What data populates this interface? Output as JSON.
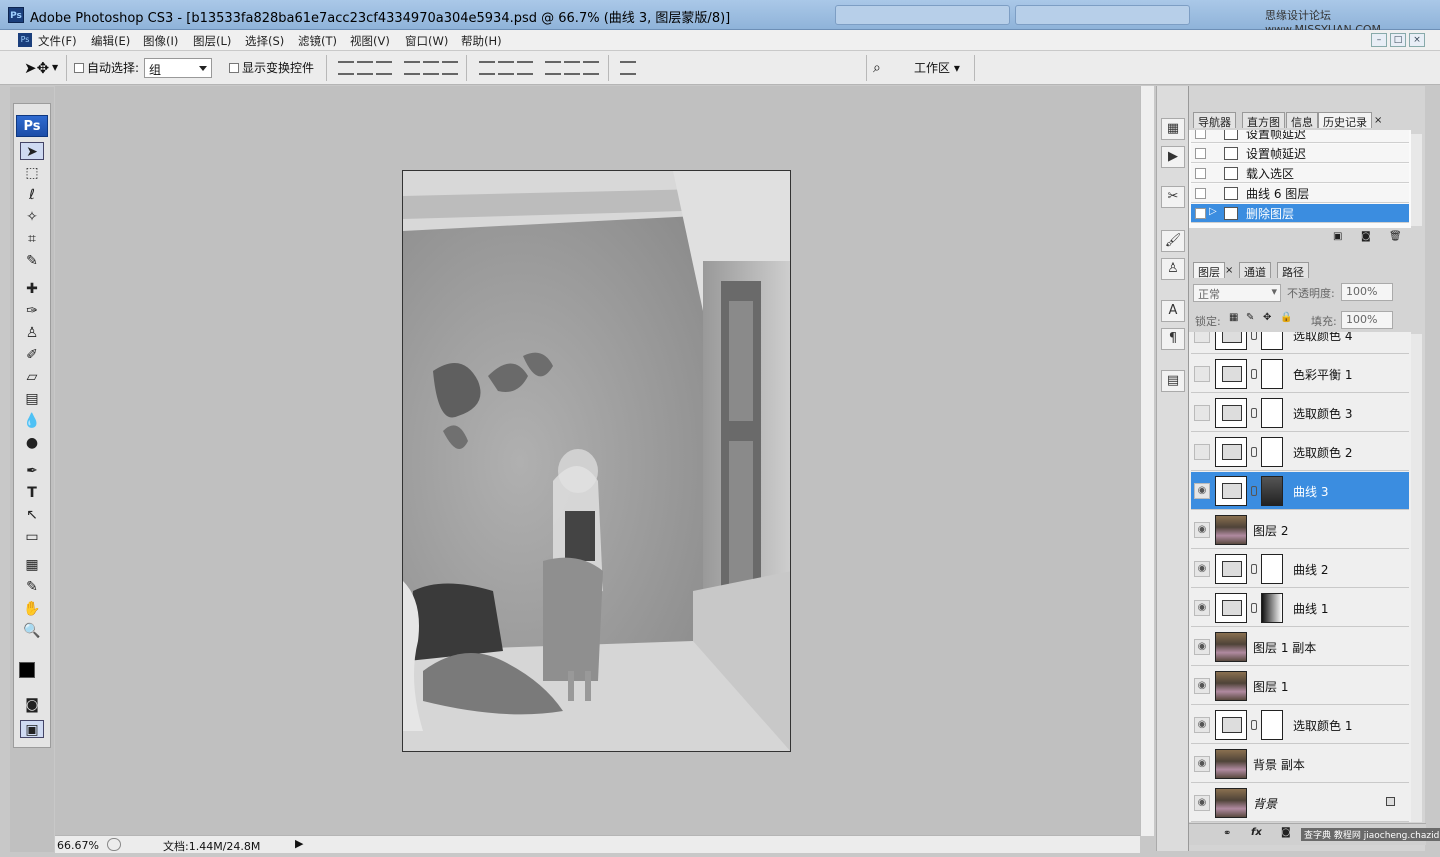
{
  "window": {
    "title": "Adobe Photoshop CS3 - [b13533fa828ba61e7acc23cf4334970a304e5934.psd @ 66.7% (曲线 3, 图层蒙版/8)]",
    "app_icon": "Ps",
    "watermark": "思缘设计论坛 www.MISSYUAN.COM"
  },
  "menu": {
    "items": [
      "文件(F)",
      "编辑(E)",
      "图像(I)",
      "图层(L)",
      "选择(S)",
      "滤镜(T)",
      "视图(V)",
      "窗口(W)",
      "帮助(H)"
    ],
    "window_buttons": [
      "–",
      "□",
      "×"
    ]
  },
  "options": {
    "auto_select_label": "自动选择:",
    "auto_select_value": "组",
    "show_transform_label": "显示变换控件",
    "workspace_label": "工作区 ▾"
  },
  "toolbox": {
    "logo": "Ps"
  },
  "status": {
    "zoom": "66.67%",
    "doc": "文档:1.44M/24.8M"
  },
  "history_panel": {
    "tabs": [
      "导航器",
      "直方图",
      "信息",
      "历史记录"
    ],
    "active_tab": "历史记录",
    "items": [
      "设置帧延迟",
      "设置帧延迟",
      "载入选区",
      "曲线 6 图层",
      "删除图层"
    ],
    "selected_index": 4
  },
  "layers_panel": {
    "tabs": [
      "图层",
      "通道",
      "路径"
    ],
    "blend_mode": "正常",
    "opacity_label": "不透明度:",
    "opacity": "100%",
    "lock_label": "锁定:",
    "fill_label": "填充:",
    "fill": "100%",
    "layers": [
      {
        "name": "选取颜色 4",
        "visible": false,
        "type": "adj",
        "mask": "white"
      },
      {
        "name": "色彩平衡 1",
        "visible": false,
        "type": "adj",
        "mask": "white"
      },
      {
        "name": "选取颜色 3",
        "visible": false,
        "type": "adj",
        "mask": "white"
      },
      {
        "name": "选取颜色 2",
        "visible": false,
        "type": "adj",
        "mask": "white"
      },
      {
        "name": "曲线 3",
        "visible": true,
        "type": "adj",
        "mask": "dark",
        "selected": true
      },
      {
        "name": "图层 2",
        "visible": true,
        "type": "img"
      },
      {
        "name": "曲线 2",
        "visible": true,
        "type": "adj",
        "mask": "white"
      },
      {
        "name": "曲线 1",
        "visible": true,
        "type": "adj",
        "mask": "gradient"
      },
      {
        "name": "图层 1 副本",
        "visible": true,
        "type": "img"
      },
      {
        "name": "图层 1",
        "visible": true,
        "type": "img"
      },
      {
        "name": "选取颜色 1",
        "visible": true,
        "type": "adj",
        "mask": "white"
      },
      {
        "name": "背景 副本",
        "visible": true,
        "type": "img"
      },
      {
        "name": "背景",
        "visible": true,
        "type": "img",
        "locked": true,
        "italic": true
      }
    ],
    "footer_icons": [
      "link-icon",
      "fx-icon",
      "mask-icon",
      "adjustment-icon",
      "folder-icon",
      "new-layer-icon",
      "trash-icon"
    ],
    "footer_watermark": "查字典 教程网 jiaocheng.chazidian.com"
  },
  "colors": {
    "selection": "#3b8de0",
    "panel_bg": "#d4d4d4",
    "canvas_bg": "#c0c0c0"
  }
}
